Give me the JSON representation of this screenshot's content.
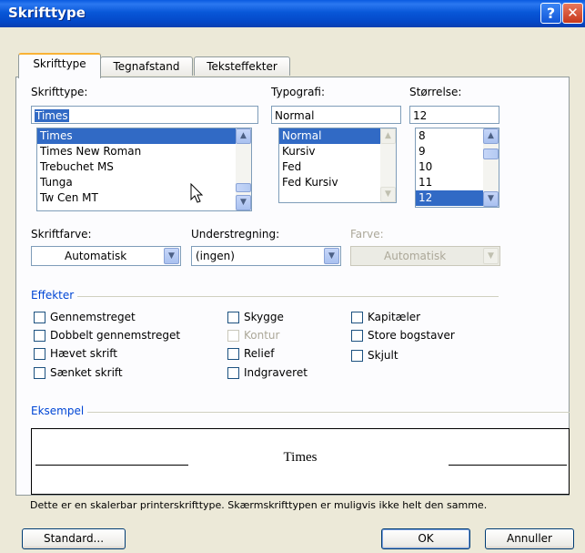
{
  "window": {
    "title": "Skrifttype"
  },
  "tabs": [
    {
      "label": "Skrifttype",
      "active": true
    },
    {
      "label": "Tegnafstand",
      "active": false
    },
    {
      "label": "Teksteffekter",
      "active": false
    }
  ],
  "font": {
    "label": "Skrifttype:",
    "value": "Times",
    "items": [
      "Times",
      "Times New Roman",
      "Trebuchet MS",
      "Tunga",
      "Tw Cen MT"
    ],
    "selected": "Times"
  },
  "style": {
    "label": "Typografi:",
    "value": "Normal",
    "items": [
      "Normal",
      "Kursiv",
      "Fed",
      "Fed Kursiv"
    ],
    "selected": "Normal"
  },
  "size": {
    "label": "Størrelse:",
    "value": "12",
    "items": [
      "8",
      "9",
      "10",
      "11",
      "12"
    ],
    "selected": "12"
  },
  "color": {
    "label": "Skriftfarve:",
    "value": "Automatisk"
  },
  "underline": {
    "label": "Understregning:",
    "value": "(ingen)"
  },
  "underline_color": {
    "label": "Farve:",
    "value": "Automatisk",
    "disabled": true
  },
  "effects": {
    "label": "Effekter",
    "col1": [
      "Gennemstreget",
      "Dobbelt gennemstreget",
      "Hævet skrift",
      "Sænket skrift"
    ],
    "col2": [
      "Skygge",
      "Kontur",
      "Relief",
      "Indgraveret"
    ],
    "col3": [
      "Kapitæler",
      "Store bogstaver",
      "Skjult"
    ],
    "disabled": [
      "Kontur"
    ]
  },
  "preview": {
    "label": "Eksempel",
    "sample": "Times",
    "note": "Dette er en skalerbar printerskrifttype. Skærmskrifttypen er muligvis ikke helt den samme."
  },
  "buttons": {
    "default": "Standard...",
    "ok": "OK",
    "cancel": "Annuller"
  },
  "colors": {
    "title_bar": "#0a5be0",
    "selection": "#316ac5",
    "group_label": "#0046d5",
    "dialog_bg": "#ece9d8"
  }
}
